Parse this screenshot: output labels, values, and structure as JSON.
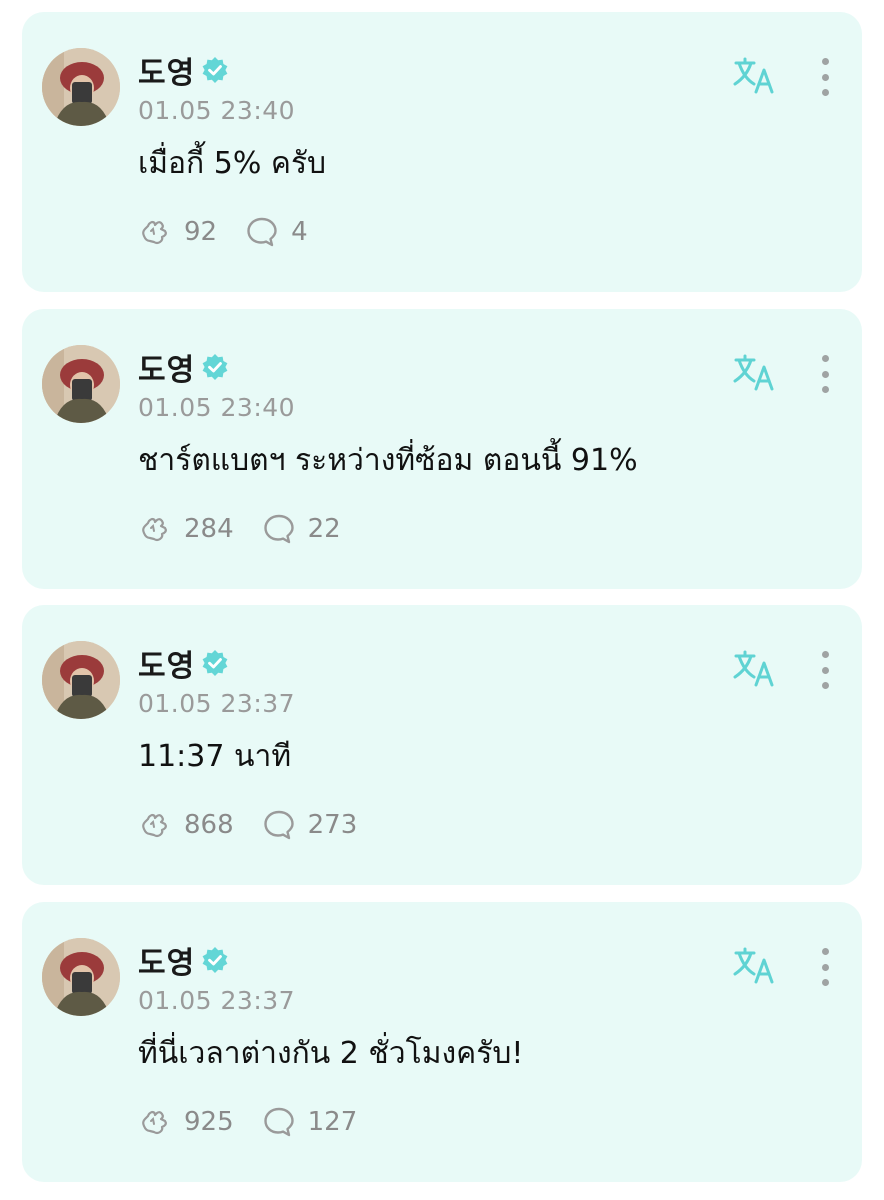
{
  "theme": {
    "card_background": "#e8faf7",
    "accent": "#5fd3d3",
    "verified_color": "#63d6d6"
  },
  "posts": [
    {
      "author": "도영",
      "timestamp": "01.05 23:40",
      "text": "เมื่อกี้ 5% ครับ",
      "likes": "92",
      "comments": "4"
    },
    {
      "author": "도영",
      "timestamp": "01.05 23:40",
      "text": "ชาร์ตแบตฯ ระหว่างที่ซ้อม ตอนนี้ 91%",
      "likes": "284",
      "comments": "22"
    },
    {
      "author": "도영",
      "timestamp": "01.05 23:37",
      "text": "11:37 นาที",
      "likes": "868",
      "comments": "273"
    },
    {
      "author": "도영",
      "timestamp": "01.05 23:37",
      "text": "ที่นี่เวลาต่างกัน 2 ชั่วโมงครับ!",
      "likes": "925",
      "comments": "127"
    }
  ],
  "icons": {
    "verified": "verified-badge-icon",
    "translate": "translate-icon",
    "more": "more-vertical-icon",
    "like": "like-icon",
    "comment": "comment-icon"
  }
}
